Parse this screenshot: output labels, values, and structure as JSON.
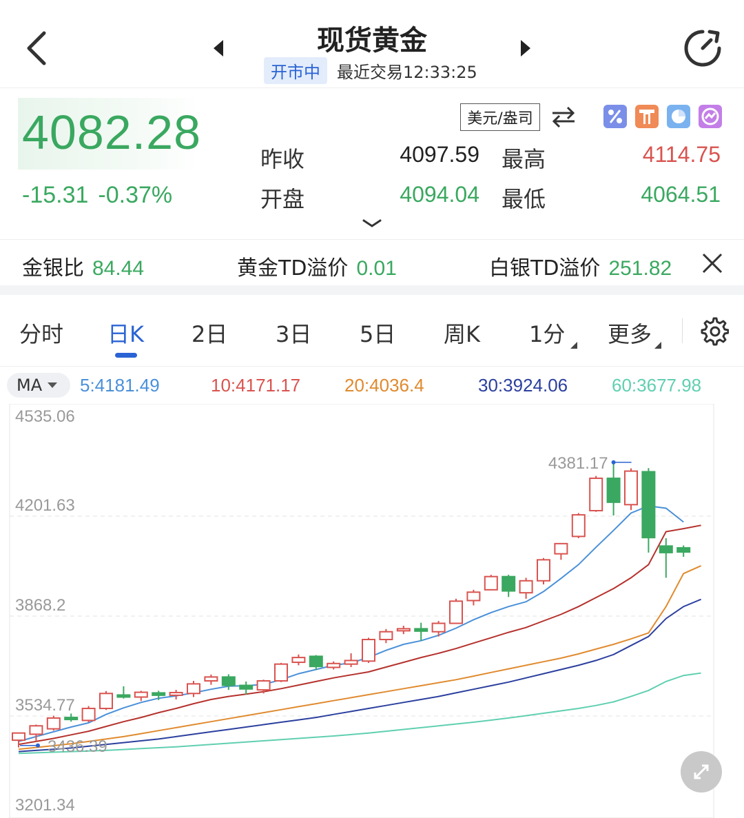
{
  "header": {
    "title": "现货黄金",
    "status": "开市中",
    "last_trade": "最近交易12:33:25"
  },
  "quote": {
    "price": "4082.28",
    "change": "-15.31",
    "change_pct": "-0.37%",
    "unit": "美元/盎司",
    "prev_close_label": "昨收",
    "prev_close": "4097.59",
    "open_label": "开盘",
    "open": "4094.04",
    "high_label": "最高",
    "high": "4114.75",
    "low_label": "最低",
    "low": "4064.51",
    "tool_icons": [
      "percent-icon",
      "lighthouse-icon",
      "pie-chart-icon",
      "compare-icon"
    ]
  },
  "ratios": [
    {
      "label": "金银比",
      "value": "84.44"
    },
    {
      "label": "黄金TD溢价",
      "value": "0.01"
    },
    {
      "label": "白银TD溢价",
      "value": "251.82"
    }
  ],
  "tabs": [
    {
      "label": "分时",
      "active": false
    },
    {
      "label": "日K",
      "active": true
    },
    {
      "label": "2日",
      "active": false
    },
    {
      "label": "3日",
      "active": false
    },
    {
      "label": "5日",
      "active": false
    },
    {
      "label": "周K",
      "active": false
    },
    {
      "label": "1分",
      "active": false,
      "dropdown": true
    },
    {
      "label": "更多",
      "active": false,
      "dropdown": true
    }
  ],
  "ma": {
    "selector": "MA",
    "items": [
      {
        "label": "5:4181.49",
        "color": "#4a90d9"
      },
      {
        "label": "10:4171.17",
        "color": "#d9534f"
      },
      {
        "label": "20:4036.4",
        "color": "#e08a2e"
      },
      {
        "label": "30:3924.06",
        "color": "#2b3f9e"
      },
      {
        "label": "60:3677.98",
        "color": "#5fcfb0"
      }
    ]
  },
  "colors": {
    "up": "#d9534f",
    "down": "#3aa860",
    "accent": "#2a63d4"
  },
  "chart_data": {
    "type": "candlestick",
    "y_ticks": [
      "4535.06",
      "4201.63",
      "3868.2",
      "3534.77",
      "3201.34"
    ],
    "ylim": [
      3201.34,
      4535.06
    ],
    "max_label": "4381.17",
    "min_label": "3436.39",
    "candles": [
      {
        "o": 3454,
        "h": 3476,
        "l": 3430,
        "c": 3478
      },
      {
        "o": 3474,
        "h": 3506,
        "l": 3450,
        "c": 3502
      },
      {
        "o": 3492,
        "h": 3536,
        "l": 3486,
        "c": 3528
      },
      {
        "o": 3530,
        "h": 3543,
        "l": 3516,
        "c": 3524
      },
      {
        "o": 3520,
        "h": 3568,
        "l": 3514,
        "c": 3560
      },
      {
        "o": 3560,
        "h": 3618,
        "l": 3555,
        "c": 3610
      },
      {
        "o": 3605,
        "h": 3634,
        "l": 3593,
        "c": 3598
      },
      {
        "o": 3598,
        "h": 3619,
        "l": 3585,
        "c": 3614
      },
      {
        "o": 3612,
        "h": 3619,
        "l": 3588,
        "c": 3604
      },
      {
        "o": 3604,
        "h": 3622,
        "l": 3590,
        "c": 3613
      },
      {
        "o": 3610,
        "h": 3652,
        "l": 3598,
        "c": 3642
      },
      {
        "o": 3652,
        "h": 3673,
        "l": 3639,
        "c": 3665
      },
      {
        "o": 3665,
        "h": 3674,
        "l": 3622,
        "c": 3637
      },
      {
        "o": 3637,
        "h": 3650,
        "l": 3606,
        "c": 3625
      },
      {
        "o": 3622,
        "h": 3656,
        "l": 3610,
        "c": 3652
      },
      {
        "o": 3652,
        "h": 3712,
        "l": 3648,
        "c": 3708
      },
      {
        "o": 3714,
        "h": 3740,
        "l": 3704,
        "c": 3730
      },
      {
        "o": 3734,
        "h": 3738,
        "l": 3688,
        "c": 3700
      },
      {
        "o": 3697,
        "h": 3717,
        "l": 3690,
        "c": 3710
      },
      {
        "o": 3708,
        "h": 3744,
        "l": 3698,
        "c": 3720
      },
      {
        "o": 3718,
        "h": 3796,
        "l": 3712,
        "c": 3790
      },
      {
        "o": 3790,
        "h": 3825,
        "l": 3778,
        "c": 3816
      },
      {
        "o": 3820,
        "h": 3836,
        "l": 3808,
        "c": 3826
      },
      {
        "o": 3826,
        "h": 3846,
        "l": 3786,
        "c": 3818
      },
      {
        "o": 3816,
        "h": 3852,
        "l": 3800,
        "c": 3844
      },
      {
        "o": 3844,
        "h": 3926,
        "l": 3842,
        "c": 3918
      },
      {
        "o": 3920,
        "h": 3956,
        "l": 3904,
        "c": 3948
      },
      {
        "o": 3956,
        "h": 4006,
        "l": 3954,
        "c": 4000
      },
      {
        "o": 4000,
        "h": 4006,
        "l": 3932,
        "c": 3952
      },
      {
        "o": 3946,
        "h": 3996,
        "l": 3926,
        "c": 3986
      },
      {
        "o": 3986,
        "h": 4062,
        "l": 3974,
        "c": 4056
      },
      {
        "o": 4076,
        "h": 4110,
        "l": 4056,
        "c": 4110
      },
      {
        "o": 4134,
        "h": 4212,
        "l": 4128,
        "c": 4206
      },
      {
        "o": 4220,
        "h": 4336,
        "l": 4216,
        "c": 4328
      },
      {
        "o": 4328,
        "h": 4381,
        "l": 4204,
        "c": 4248
      },
      {
        "o": 4240,
        "h": 4361,
        "l": 4222,
        "c": 4352
      },
      {
        "o": 4350,
        "h": 4362,
        "l": 4080,
        "c": 4130
      },
      {
        "o": 4102,
        "h": 4128,
        "l": 3996,
        "c": 4080
      },
      {
        "o": 4096,
        "h": 4104,
        "l": 4066,
        "c": 4082
      }
    ],
    "ma5": [
      3450,
      3466,
      3482,
      3498,
      3512,
      3540,
      3562,
      3580,
      3594,
      3602,
      3612,
      3624,
      3634,
      3636,
      3640,
      3656,
      3676,
      3690,
      3704,
      3712,
      3730,
      3754,
      3774,
      3786,
      3804,
      3828,
      3856,
      3880,
      3900,
      3916,
      3950,
      3994,
      4040,
      4098,
      4154,
      4212,
      4236,
      4228,
      4182
    ],
    "ma10": [
      3440,
      3450,
      3460,
      3472,
      3484,
      3500,
      3516,
      3530,
      3546,
      3560,
      3576,
      3590,
      3600,
      3608,
      3616,
      3626,
      3638,
      3650,
      3662,
      3672,
      3682,
      3698,
      3714,
      3730,
      3744,
      3760,
      3778,
      3796,
      3814,
      3830,
      3852,
      3874,
      3900,
      3930,
      3960,
      3996,
      4040,
      4150,
      4160,
      4171
    ],
    "ma20": [
      3424,
      3430,
      3436,
      3442,
      3450,
      3458,
      3466,
      3476,
      3486,
      3496,
      3506,
      3516,
      3526,
      3536,
      3546,
      3556,
      3566,
      3576,
      3586,
      3596,
      3606,
      3616,
      3626,
      3636,
      3646,
      3656,
      3668,
      3680,
      3692,
      3704,
      3716,
      3728,
      3742,
      3758,
      3774,
      3792,
      3812,
      3900,
      4010,
      4036
    ],
    "ma30": [
      3416,
      3420,
      3424,
      3428,
      3434,
      3440,
      3446,
      3452,
      3458,
      3466,
      3474,
      3482,
      3490,
      3498,
      3506,
      3514,
      3522,
      3530,
      3540,
      3550,
      3560,
      3570,
      3580,
      3590,
      3600,
      3612,
      3624,
      3636,
      3648,
      3662,
      3676,
      3690,
      3704,
      3720,
      3740,
      3770,
      3800,
      3860,
      3900,
      3924
    ],
    "ma60": [
      3410,
      3412,
      3414,
      3416,
      3418,
      3420,
      3423,
      3426,
      3429,
      3432,
      3436,
      3440,
      3444,
      3448,
      3452,
      3456,
      3460,
      3464,
      3468,
      3473,
      3478,
      3484,
      3490,
      3496,
      3502,
      3508,
      3514,
      3521,
      3528,
      3536,
      3544,
      3552,
      3560,
      3570,
      3582,
      3600,
      3620,
      3650,
      3670,
      3678
    ]
  }
}
